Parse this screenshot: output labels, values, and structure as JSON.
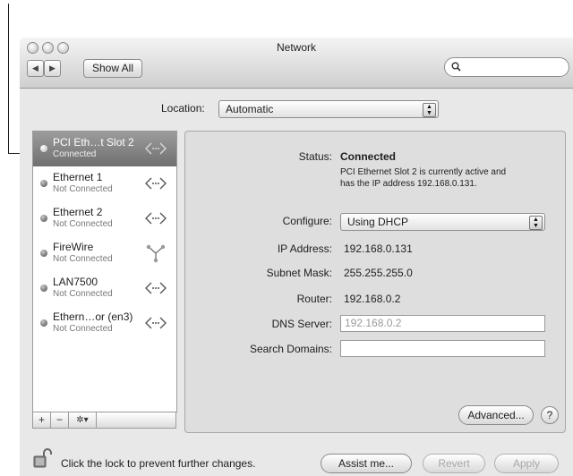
{
  "window": {
    "title": "Network"
  },
  "toolbar": {
    "back_icon": "◀",
    "forward_icon": "▶",
    "show_all_label": "Show All",
    "search_placeholder": ""
  },
  "location": {
    "label": "Location:",
    "value": "Automatic"
  },
  "services": [
    {
      "name": "PCI Eth…t Slot 2",
      "status": "Connected",
      "selected": true,
      "icon": "ethernet-arrows-icon"
    },
    {
      "name": "Ethernet 1",
      "status": "Not Connected",
      "selected": false,
      "icon": "ethernet-arrows-icon"
    },
    {
      "name": "Ethernet 2",
      "status": "Not Connected",
      "selected": false,
      "icon": "ethernet-arrows-icon"
    },
    {
      "name": "FireWire",
      "status": "Not Connected",
      "selected": false,
      "icon": "firewire-icon"
    },
    {
      "name": "LAN7500",
      "status": "Not Connected",
      "selected": false,
      "icon": "ethernet-arrows-icon"
    },
    {
      "name": "Ethern…or (en3)",
      "status": "Not Connected",
      "selected": false,
      "icon": "ethernet-arrows-icon"
    }
  ],
  "list_tools": {
    "add": "+",
    "remove": "−",
    "gear": "✲▾"
  },
  "detail": {
    "status_label": "Status:",
    "status_value": "Connected",
    "status_desc_line1": "PCI Ethernet Slot 2 is currently active and",
    "status_desc_line2": "has the IP address 192.168.0.131.",
    "configure_label": "Configure:",
    "configure_value": "Using DHCP",
    "ip_label": "IP Address:",
    "ip_value": "192.168.0.131",
    "subnet_label": "Subnet Mask:",
    "subnet_value": "255.255.255.0",
    "router_label": "Router:",
    "router_value": "192.168.0.2",
    "dns_label": "DNS Server:",
    "dns_value": "192.168.0.2",
    "search_domains_label": "Search Domains:",
    "search_domains_value": "",
    "advanced_label": "Advanced...",
    "help_label": "?"
  },
  "footer": {
    "lock_text": "Click the lock to prevent further changes.",
    "assist_label": "Assist me...",
    "revert_label": "Revert",
    "apply_label": "Apply"
  }
}
